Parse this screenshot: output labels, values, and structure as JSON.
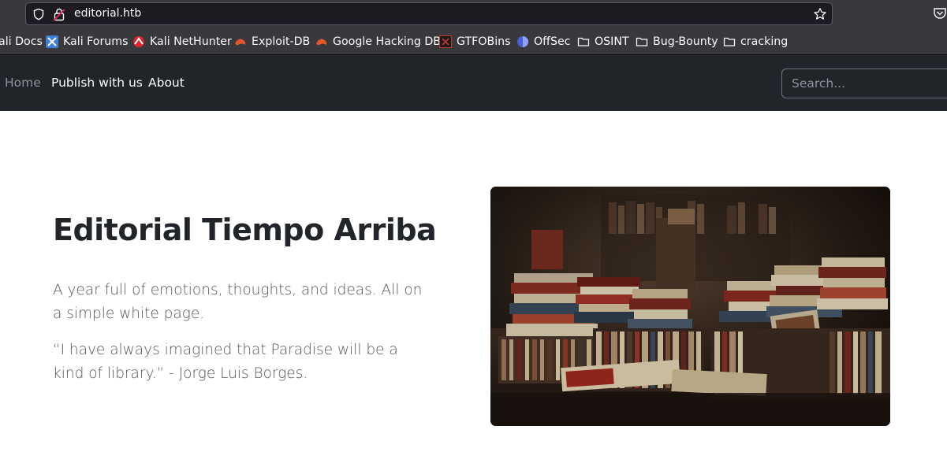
{
  "browser": {
    "url": "editorial.htb",
    "bookmarks": [
      {
        "label": "ali Docs",
        "icon": "kali-docs-icon"
      },
      {
        "label": "Kali Forums",
        "icon": "kali-forums-icon"
      },
      {
        "label": "Kali NetHunter",
        "icon": "kali-nethunter-icon"
      },
      {
        "label": "Exploit-DB",
        "icon": "exploit-db-icon"
      },
      {
        "label": "Google Hacking DB",
        "icon": "ghdb-icon"
      },
      {
        "label": "GTFOBins",
        "icon": "gtfobins-icon"
      },
      {
        "label": "OffSec",
        "icon": "offsec-icon"
      },
      {
        "label": "OSINT",
        "icon": "folder-icon"
      },
      {
        "label": "Bug-Bounty",
        "icon": "folder-icon"
      },
      {
        "label": "cracking",
        "icon": "folder-icon"
      }
    ]
  },
  "navbar": {
    "home": "Home",
    "publish": "Publish with us",
    "about": "About",
    "search_placeholder": "Search..."
  },
  "hero": {
    "title": "Editorial Tiempo Arriba",
    "paragraph1": "A year full of emotions, thoughts, and ideas. All on a simple white page.",
    "paragraph2": "“I have always imagined that Paradise will be a kind of library.” - Jorge Luis Borges."
  },
  "colors": {
    "chrome": "#38383d",
    "navbar": "#212529",
    "title": "#212529",
    "text": "#52585e"
  }
}
